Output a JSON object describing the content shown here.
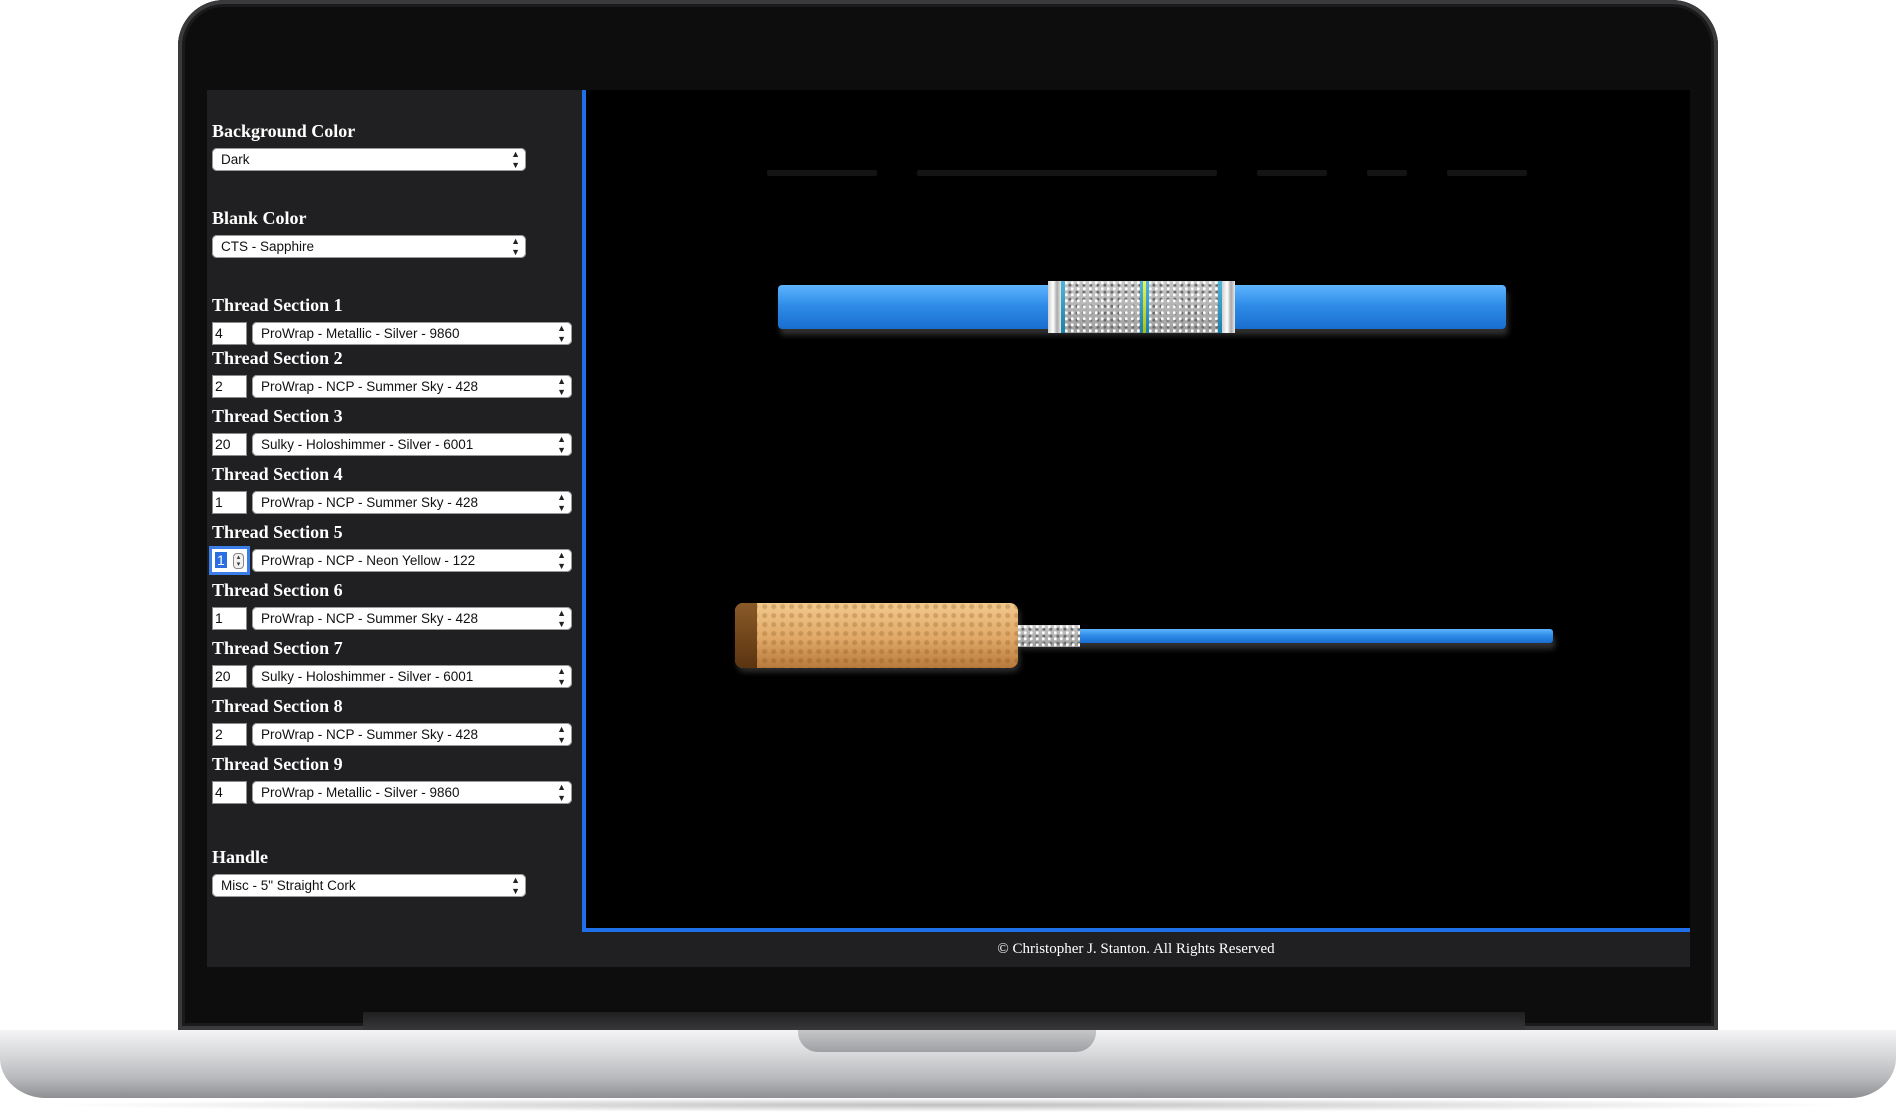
{
  "sidebar": {
    "background_color": {
      "label": "Background Color",
      "value": "Dark"
    },
    "blank_color": {
      "label": "Blank Color",
      "value": "CTS - Sapphire"
    },
    "thread_sections": [
      {
        "label": "Thread Section 1",
        "turns": "4",
        "thread": "ProWrap - Metallic - Silver - 9860"
      },
      {
        "label": "Thread Section 2",
        "turns": "2",
        "thread": "ProWrap - NCP - Summer Sky - 428"
      },
      {
        "label": "Thread Section 3",
        "turns": "20",
        "thread": "Sulky - Holoshimmer - Silver - 6001"
      },
      {
        "label": "Thread Section 4",
        "turns": "1",
        "thread": "ProWrap - NCP - Summer Sky - 428"
      },
      {
        "label": "Thread Section 5",
        "turns": "1",
        "thread": "ProWrap - NCP - Neon Yellow - 122"
      },
      {
        "label": "Thread Section 6",
        "turns": "1",
        "thread": "ProWrap - NCP - Summer Sky - 428"
      },
      {
        "label": "Thread Section 7",
        "turns": "20",
        "thread": "Sulky - Holoshimmer - Silver - 6001"
      },
      {
        "label": "Thread Section 8",
        "turns": "2",
        "thread": "ProWrap - NCP - Summer Sky - 428"
      },
      {
        "label": "Thread Section 9",
        "turns": "4",
        "thread": "ProWrap - Metallic - Silver - 9860"
      }
    ],
    "handle": {
      "label": "Handle",
      "value": "Misc - 5\" Straight Cork"
    }
  },
  "footer": {
    "copyright": "© Christopher J. Stanton. All Rights Reserved"
  },
  "colors": {
    "accent": "#1f6fe8",
    "blank": "#2f8de8",
    "summer_sky": "#2a90b8",
    "neon_yellow": "#d4e83a"
  }
}
